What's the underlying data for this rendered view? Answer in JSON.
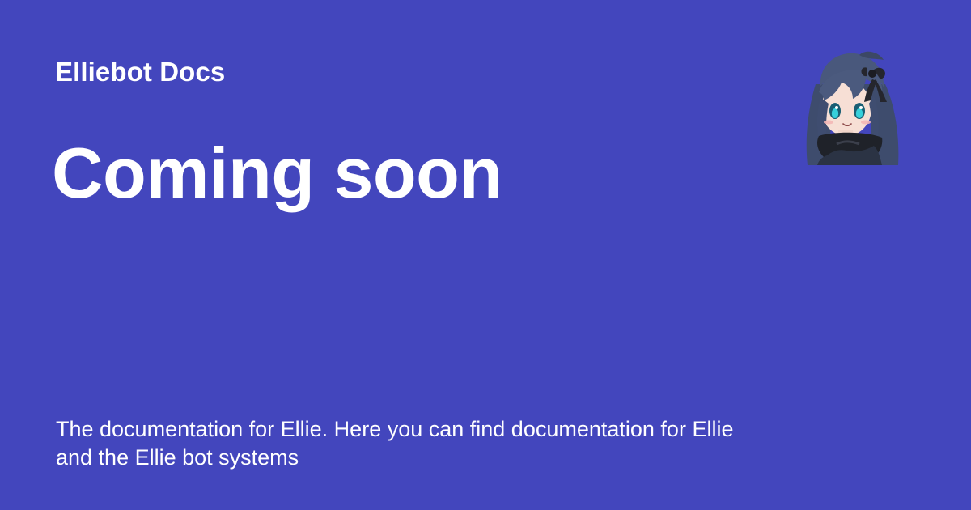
{
  "card": {
    "background_color": "#4346bd",
    "site_title": "Elliebot Docs",
    "page_title": "Coming soon",
    "description": "The documentation for Ellie. Here you can find documentation for Ellie and the Ellie bot systems",
    "avatar_icon": "anime-girl-avatar-icon"
  }
}
